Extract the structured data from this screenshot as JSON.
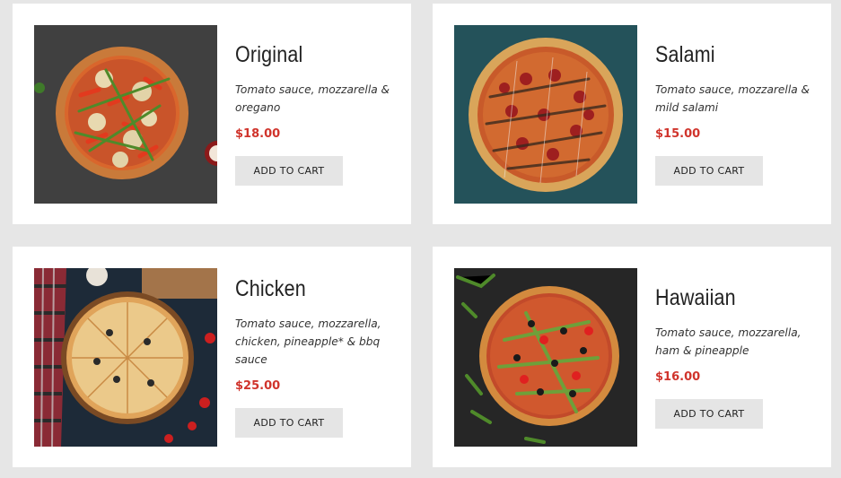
{
  "products": [
    {
      "name": "Original",
      "description": "Tomato sauce, mozzarella & oregano",
      "price": "$18.00",
      "button": "ADD TO CART",
      "image": "pizza-original-image"
    },
    {
      "name": "Salami",
      "description": "Tomato sauce, mozzarella & mild salami",
      "price": "$15.00",
      "button": "ADD TO CART",
      "image": "pizza-salami-image"
    },
    {
      "name": "Chicken",
      "description": "Tomato sauce, mozzarella, chicken, pineapple* & bbq sauce",
      "price": "$25.00",
      "button": "ADD TO CART",
      "image": "pizza-chicken-image"
    },
    {
      "name": "Hawaiian",
      "description": "Tomato sauce, mozzarella, ham & pineapple",
      "price": "$16.00",
      "button": "ADD TO CART",
      "image": "pizza-hawaiian-image"
    }
  ],
  "colors": {
    "page_background": "#e6e6e6",
    "card_background": "#ffffff",
    "price": "#d0342c",
    "button_background": "#e5e5e5",
    "title_text": "#222222"
  }
}
